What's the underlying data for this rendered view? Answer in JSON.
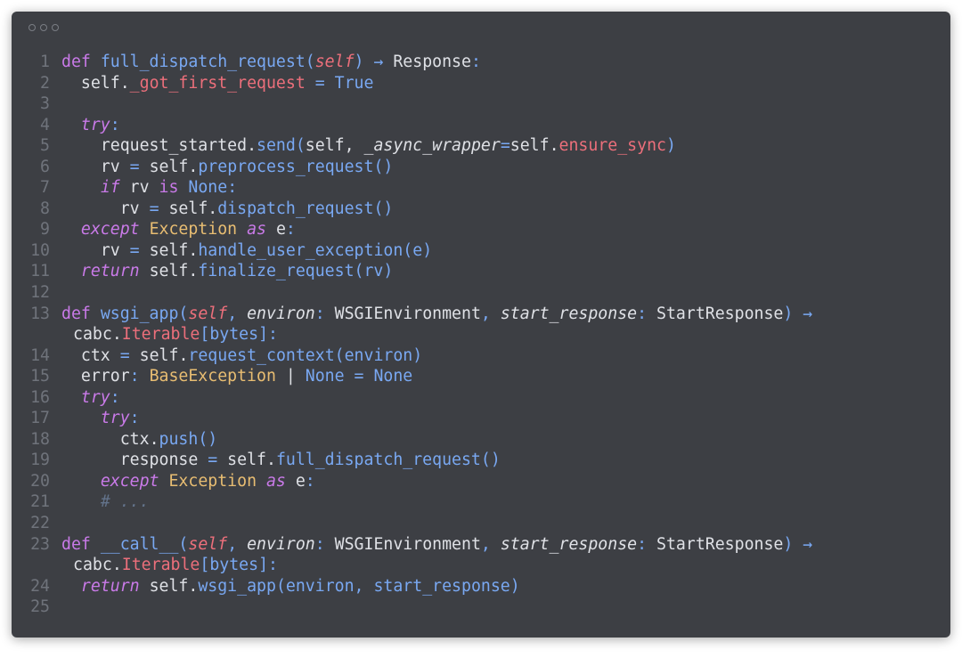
{
  "window": {
    "dots": [
      "close",
      "minimize",
      "zoom"
    ]
  },
  "code": {
    "line_numbers": [
      "1",
      "2",
      "3",
      "4",
      "5",
      "6",
      "7",
      "8",
      "9",
      "10",
      "11",
      "12",
      "13",
      "14",
      "15",
      "16",
      "17",
      "18",
      "19",
      "20",
      "21",
      "22",
      "23",
      "24",
      "25"
    ],
    "tokens": {
      "def": "def",
      "try": "try",
      "except": "except",
      "return": "return",
      "if": "if",
      "as": "as",
      "is": "is",
      "None": "None",
      "True": "True",
      "self": "self",
      "arrow": "→",
      "full_dispatch_request": "full_dispatch_request",
      "response_type": "Response",
      "got_first_request": "_got_first_request",
      "request_started": "request_started",
      "send": "send",
      "async_wrapper": "_async_wrapper",
      "ensure_sync": "ensure_sync",
      "rv": "rv",
      "preprocess_request": "preprocess_request",
      "dispatch_request": "dispatch_request",
      "exception": "Exception",
      "e": "e",
      "handle_user_exception": "handle_user_exception",
      "finalize_request": "finalize_request",
      "wsgi_app": "wsgi_app",
      "environ": "environ",
      "wsgi_environment": "WSGIEnvironment",
      "start_response": "start_response",
      "start_response_type": "StartResponse",
      "cabc": "cabc",
      "iterable": "Iterable",
      "bytes": "bytes",
      "ctx": "ctx",
      "request_context": "request_context",
      "error": "error",
      "base_exception": "BaseException",
      "push": "push",
      "response": "response",
      "comment": "# ...",
      "call": "__call__"
    }
  }
}
